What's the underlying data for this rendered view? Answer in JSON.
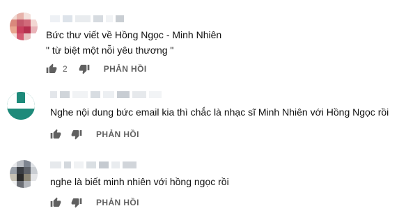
{
  "comments": [
    {
      "text_lines": [
        "Bức thư viết về Hồng Ngọc - Minh Nhiên",
        "\" từ biệt một nỗi yêu thương \""
      ],
      "likes": "2",
      "reply_label": "PHẢN HỒI",
      "avatar_style": "pixelated-pink"
    },
    {
      "text_lines": [
        "Nghe nội dung bức email kia thì chắc là nhạc sĩ Minh Nhiên với Hồng Ngọc rồi"
      ],
      "likes": "",
      "reply_label": "PHẢN HỒI",
      "avatar_style": "teal-cross"
    },
    {
      "text_lines": [
        "nghe là biết minh nhiên với hồng ngọc rồi"
      ],
      "likes": "",
      "reply_label": "PHẢN HỒI",
      "avatar_style": "pixelated-gray"
    }
  ],
  "icons": {
    "like": "thumb-up-icon",
    "dislike": "thumb-down-icon"
  },
  "colors": {
    "text": "#0f0f0f",
    "secondary": "#606060",
    "teal_avatar": "#1e8a7a"
  }
}
